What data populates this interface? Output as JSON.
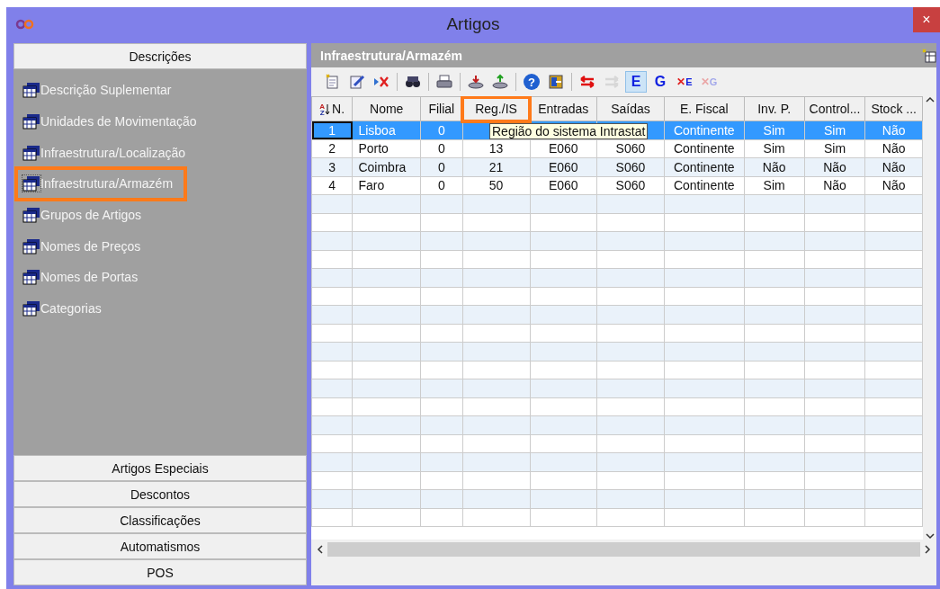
{
  "window": {
    "title": "Artigos",
    "close": "×"
  },
  "sidebar": {
    "header": "Descrições",
    "items": [
      {
        "label": "Descrição Suplementar",
        "selected": false,
        "highlighted": false
      },
      {
        "label": "Unidades de Movimentação",
        "selected": false,
        "highlighted": false
      },
      {
        "label": "Infraestrutura/Localização",
        "selected": false,
        "highlighted": false
      },
      {
        "label": "Infraestrutura/Armazém",
        "selected": true,
        "highlighted": true
      },
      {
        "label": "Grupos de Artigos",
        "selected": false,
        "highlighted": false
      },
      {
        "label": "Nomes de Preços",
        "selected": false,
        "highlighted": false
      },
      {
        "label": "Nomes de Portas",
        "selected": false,
        "highlighted": false
      },
      {
        "label": "Categorias",
        "selected": false,
        "highlighted": false
      }
    ],
    "sections": [
      "Artigos Especiais",
      "Descontos",
      "Classificações",
      "Automatismos",
      "POS"
    ]
  },
  "panel": {
    "title": "Infraestrutura/Armazém",
    "toolbar": [
      {
        "kind": "new",
        "disabled": false
      },
      {
        "kind": "edit",
        "disabled": false
      },
      {
        "kind": "delete",
        "disabled": false
      },
      {
        "kind": "sep"
      },
      {
        "kind": "find",
        "disabled": false
      },
      {
        "kind": "sep"
      },
      {
        "kind": "print",
        "disabled": false
      },
      {
        "kind": "sep"
      },
      {
        "kind": "import",
        "disabled": false
      },
      {
        "kind": "export",
        "disabled": false
      },
      {
        "kind": "sep"
      },
      {
        "kind": "help",
        "glyph": "?",
        "disabled": false
      },
      {
        "kind": "exit",
        "disabled": false
      },
      {
        "kind": "sep"
      },
      {
        "kind": "swap",
        "disabled": false
      },
      {
        "kind": "move",
        "disabled": true
      },
      {
        "kind": "letter",
        "label": "E",
        "selected": true,
        "disabled": false
      },
      {
        "kind": "letter",
        "label": "G",
        "selected": false,
        "disabled": false
      },
      {
        "kind": "clear",
        "glyph": "✕",
        "label": "E",
        "disabled": false
      },
      {
        "kind": "clear",
        "glyph": "✕",
        "label": "G",
        "disabled": true
      }
    ],
    "table": {
      "columns": [
        {
          "label": "N.",
          "sort": [
            "A",
            "Z"
          ],
          "highlighted": false
        },
        {
          "label": "Nome",
          "highlighted": false
        },
        {
          "label": "Filial",
          "highlighted": false
        },
        {
          "label": "Reg./IS",
          "highlighted": true
        },
        {
          "label": "Entradas",
          "highlighted": false
        },
        {
          "label": "Saídas",
          "highlighted": false
        },
        {
          "label": "E. Fiscal",
          "highlighted": false
        },
        {
          "label": "Inv. P.",
          "highlighted": false
        },
        {
          "label": "Control...",
          "highlighted": false
        },
        {
          "label": "Stock ...",
          "highlighted": false
        }
      ],
      "rows": [
        {
          "selected": true,
          "cells": [
            "1",
            "Lisboa",
            "0",
            null,
            null,
            null,
            "Continente",
            "Sim",
            "Sim",
            "Não"
          ]
        },
        {
          "selected": false,
          "cells": [
            "2",
            "Porto",
            "0",
            "13",
            "E060",
            "S060",
            "Continente",
            "Sim",
            "Sim",
            "Não"
          ]
        },
        {
          "selected": false,
          "cells": [
            "3",
            "Coimbra",
            "0",
            "21",
            "E060",
            "S060",
            "Continente",
            "Não",
            "Não",
            "Não"
          ]
        },
        {
          "selected": false,
          "cells": [
            "4",
            "Faro",
            "0",
            "50",
            "E060",
            "S060",
            "Continente",
            "Sim",
            "Não",
            "Não"
          ]
        }
      ],
      "tooltip": "Região do sistema Intrastat"
    }
  }
}
